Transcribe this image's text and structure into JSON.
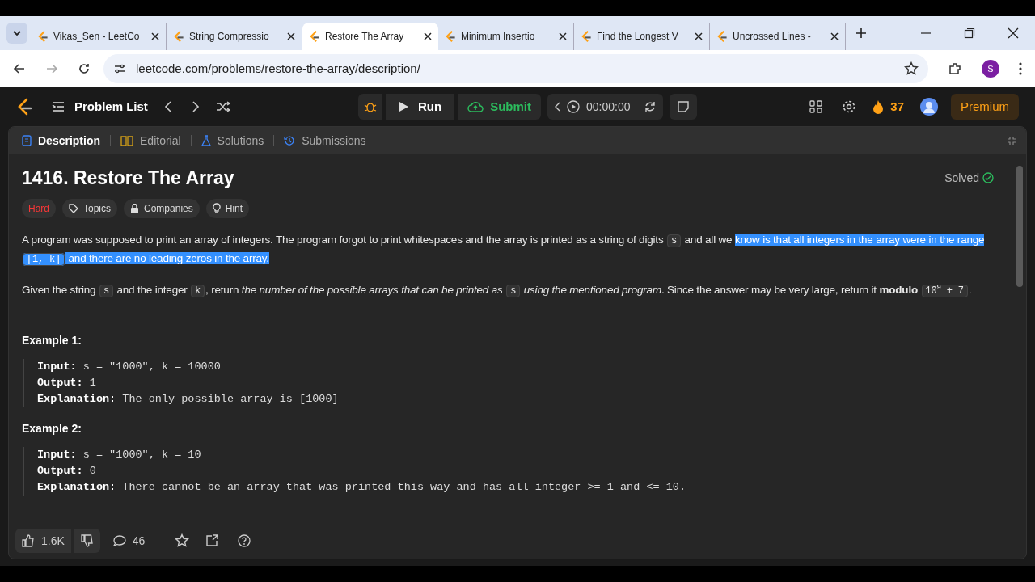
{
  "browser": {
    "tabs": [
      {
        "title": "Vikas_Sen - LeetCo",
        "selected": false
      },
      {
        "title": "String Compressio",
        "selected": false
      },
      {
        "title": "Restore The Array",
        "selected": true
      },
      {
        "title": "Minimum Insertio",
        "selected": false
      },
      {
        "title": "Find the Longest V",
        "selected": false
      },
      {
        "title": "Uncrossed Lines - ",
        "selected": false
      }
    ],
    "url": "leetcode.com/problems/restore-the-array/description/",
    "profile": "S"
  },
  "navbar": {
    "problem_list": "Problem List",
    "run": "Run",
    "submit": "Submit",
    "timer": "00:00:00",
    "streak": "37",
    "premium": "Premium"
  },
  "panel_tabs": [
    {
      "label": "Description",
      "selected": true
    },
    {
      "label": "Editorial",
      "selected": false
    },
    {
      "label": "Solutions",
      "selected": false
    },
    {
      "label": "Submissions",
      "selected": false
    }
  ],
  "problem": {
    "title": "1416. Restore The Array",
    "status": "Solved",
    "difficulty": "Hard",
    "tags": [
      "Topics",
      "Companies",
      "Hint"
    ],
    "paragraphs": [
      [
        {
          "kind": "text",
          "text": "A program was supposed to print an array of integers. The program forgot to print whitespaces and the array is printed as a string of digits ",
          "highlighted": false
        },
        {
          "kind": "code",
          "text": "s",
          "highlighted": false
        },
        {
          "kind": "text",
          "text": " and all we ",
          "highlighted": false
        },
        {
          "kind": "text",
          "text": "know is that all integers in the array were in the range ",
          "highlighted": true
        },
        {
          "kind": "code",
          "text": "[1, k]",
          "highlighted": true
        },
        {
          "kind": "text",
          "text": " and there are no leading zeros in the array.",
          "highlighted": true
        }
      ],
      [
        {
          "kind": "text",
          "text": "Given the string ",
          "highlighted": false
        },
        {
          "kind": "code",
          "text": "s",
          "highlighted": false
        },
        {
          "kind": "text",
          "text": " and the integer ",
          "highlighted": false
        },
        {
          "kind": "code",
          "text": "k",
          "highlighted": false
        },
        {
          "kind": "text",
          "text": ", return *the number of the possible arrays that can be printed as* ",
          "highlighted": false
        },
        {
          "kind": "code",
          "text": "s",
          "highlighted": false
        },
        {
          "kind": "text",
          "text": " *using the mentioned program*. Since the answer may be very large, return it **modulo** ",
          "highlighted": false
        },
        {
          "kind": "code",
          "text": "10$^{9}$ + 7",
          "highlighted": false
        },
        {
          "kind": "text",
          "text": ".",
          "highlighted": false
        }
      ]
    ],
    "examples": [
      {
        "heading": "Example 1:",
        "lines": [
          {
            "label": "Input:",
            "value": "s = \"1000\", k = 10000"
          },
          {
            "label": "Output:",
            "value": "1"
          },
          {
            "label": "Explanation:",
            "value": "The only possible array is [1000]"
          }
        ]
      },
      {
        "heading": "Example 2:",
        "lines": [
          {
            "label": "Input:",
            "value": "s = \"1000\", k = 10"
          },
          {
            "label": "Output:",
            "value": "0"
          },
          {
            "label": "Explanation:",
            "value": "There cannot be an array that was printed this way and has all integer >= 1 and <= 10."
          }
        ]
      }
    ]
  },
  "footer": {
    "likes": "1.6K",
    "comments": "46"
  }
}
